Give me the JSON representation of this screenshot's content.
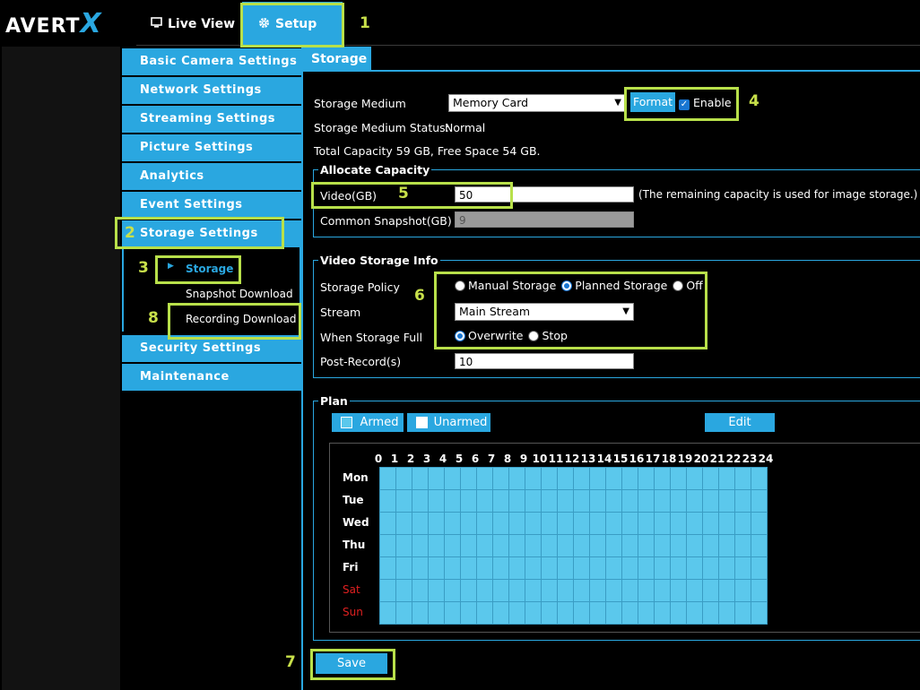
{
  "header": {
    "logo_main": "AVERT",
    "logo_x": "X",
    "tabs": [
      {
        "label": "Live View",
        "icon": "monitor-icon"
      },
      {
        "label": "Setup",
        "icon": "gear-icon"
      }
    ]
  },
  "sidebar": {
    "items": [
      {
        "label": "Basic Camera Settings"
      },
      {
        "label": "Network Settings"
      },
      {
        "label": "Streaming Settings"
      },
      {
        "label": "Picture Settings"
      },
      {
        "label": "Analytics"
      },
      {
        "label": "Event Settings"
      },
      {
        "label": "Storage Settings"
      },
      {
        "label": "Security Settings"
      },
      {
        "label": "Maintenance"
      }
    ],
    "storage_submenu": [
      {
        "label": "Storage"
      },
      {
        "label": "Snapshot Download"
      },
      {
        "label": "Recording Download"
      }
    ]
  },
  "content": {
    "tab_title": "Storage",
    "storage_medium_label": "Storage Medium",
    "storage_medium_value": "Memory Card",
    "format_button": "Format",
    "enable_label": "Enable",
    "enable_checked": true,
    "status_label": "Storage Medium Status:",
    "status_value": "Normal",
    "capacity_text": "Total Capacity 59 GB, Free Space 54 GB.",
    "allocate": {
      "legend": "Allocate Capacity",
      "video_label": "Video(GB)",
      "video_value": "50",
      "video_note": "(The remaining capacity is used for image storage.)",
      "snapshot_label": "Common Snapshot(GB)",
      "snapshot_value": "9"
    },
    "video_info": {
      "legend": "Video Storage Info",
      "policy_label": "Storage Policy",
      "policy_options": [
        "Manual Storage",
        "Planned Storage",
        "Off"
      ],
      "policy_selected": "Planned Storage",
      "stream_label": "Stream",
      "stream_value": "Main Stream",
      "full_label": "When Storage Full",
      "full_options": [
        "Overwrite",
        "Stop"
      ],
      "full_selected": "Overwrite",
      "post_record_label": "Post-Record(s)",
      "post_record_value": "10"
    },
    "plan": {
      "legend": "Plan",
      "armed_label": "Armed",
      "unarmed_label": "Unarmed",
      "edit_label": "Edit",
      "hours": [
        "0",
        "1",
        "2",
        "3",
        "4",
        "5",
        "6",
        "7",
        "8",
        "9",
        "10",
        "11",
        "12",
        "13",
        "14",
        "15",
        "16",
        "17",
        "18",
        "19",
        "20",
        "21",
        "22",
        "23",
        "24"
      ],
      "days": [
        "Mon",
        "Tue",
        "Wed",
        "Thu",
        "Fri",
        "Sat",
        "Sun"
      ],
      "weekend_color": "#e02020",
      "armed_color": "#5bc8ec"
    },
    "save_label": "Save"
  },
  "annotations": [
    "1",
    "2",
    "3",
    "4",
    "5",
    "6",
    "7",
    "8"
  ],
  "colors": {
    "accent": "#2aa7e0",
    "highlight": "#b8e04a"
  }
}
